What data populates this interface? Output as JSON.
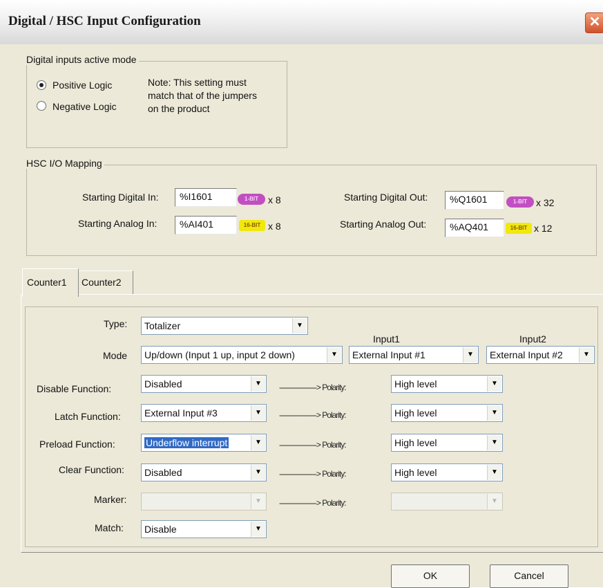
{
  "window": {
    "title": "Digital / HSC Input Configuration",
    "close_glyph": "✕"
  },
  "active_mode": {
    "label": "Digital inputs active mode",
    "options": [
      "Positive Logic",
      "Negative Logic"
    ],
    "selected": "Positive Logic",
    "note_lines": [
      "Note: This setting must",
      "match that of the jumpers",
      "on the product"
    ]
  },
  "mapping": {
    "label": "HSC I/O Mapping",
    "digital_in": {
      "label": "Starting Digital In:",
      "value": "%I1601",
      "badge": "1-BIT",
      "count": "x 8"
    },
    "analog_in": {
      "label": "Starting Analog In:",
      "value": "%AI401",
      "badge": "16-BIT",
      "count": "x 8"
    },
    "digital_out": {
      "label": "Starting Digital Out:",
      "value": "%Q1601",
      "badge": "1-BIT",
      "count": "x 32"
    },
    "analog_out": {
      "label": "Starting Analog Out:",
      "value": "%AQ401",
      "badge": "16-BIT",
      "count": "x 12"
    }
  },
  "tabs": [
    "Counter1",
    "Counter2"
  ],
  "counter": {
    "type": {
      "label": "Type:",
      "value": "Totalizer"
    },
    "mode": {
      "label": "Mode",
      "value": "Up/down (Input 1 up, input 2 down)"
    },
    "input1": {
      "label": "Input1",
      "value": "External Input #1"
    },
    "input2": {
      "label": "Input2",
      "value": "External Input #2"
    },
    "arrow_text": "------------------> Polarity:",
    "rows": [
      {
        "label": "Disable Function:",
        "value": "Disabled",
        "polarity": "High level"
      },
      {
        "label": "Latch Function:",
        "value": "External Input #3",
        "polarity": "High level"
      },
      {
        "label": "Preload Function:",
        "value": "Underflow interrupt",
        "polarity": "High level"
      },
      {
        "label": "Clear Function:",
        "value": "Disabled",
        "polarity": "High level"
      },
      {
        "label": "Marker:",
        "value": "",
        "polarity": ""
      }
    ],
    "match": {
      "label": "Match:",
      "value": "Disable"
    }
  },
  "buttons": {
    "ok": "OK",
    "cancel": "Cancel"
  },
  "colors": {
    "dialog_bg": "#ece9d8",
    "badge_1bit": "#c24fc2",
    "badge_16bit": "#f1e80c",
    "selection": "#316ac5",
    "close_button": "#d0512b"
  }
}
